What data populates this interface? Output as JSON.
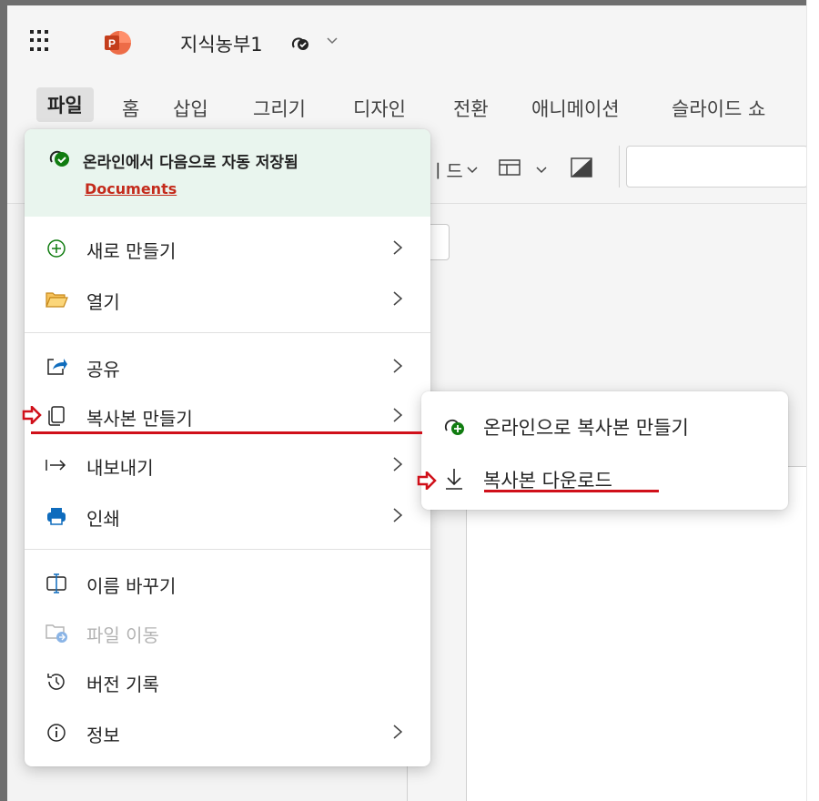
{
  "app": {
    "title": "지식농부1",
    "logo_letter": "P"
  },
  "tabs": [
    {
      "label": "파일",
      "active": true
    },
    {
      "label": "홈"
    },
    {
      "label": "삽입"
    },
    {
      "label": "그리기"
    },
    {
      "label": "디자인"
    },
    {
      "label": "전환"
    },
    {
      "label": "애니메이션"
    },
    {
      "label": "슬라이드 쇼"
    }
  ],
  "ribbon": {
    "fragment_label": "ㅣ드"
  },
  "file_menu": {
    "save_status": "온라인에서 다음으로 자동 저장됨",
    "save_location": "Documents",
    "items": [
      {
        "label": "새로 만들기",
        "icon": "plus-circle-icon",
        "has_submenu": true
      },
      {
        "label": "열기",
        "icon": "folder-open-icon",
        "has_submenu": true
      },
      {
        "label": "공유",
        "icon": "share-icon",
        "has_submenu": true
      },
      {
        "label": "복사본 만들기",
        "icon": "copy-icon",
        "has_submenu": true,
        "highlighted": true
      },
      {
        "label": "내보내기",
        "icon": "export-arrow-icon",
        "has_submenu": true
      },
      {
        "label": "인쇄",
        "icon": "printer-icon",
        "has_submenu": true
      },
      {
        "label": "이름 바꾸기",
        "icon": "rename-icon",
        "has_submenu": false
      },
      {
        "label": "파일 이동",
        "icon": "move-folder-icon",
        "has_submenu": false,
        "disabled": true
      },
      {
        "label": "버전 기록",
        "icon": "history-icon",
        "has_submenu": false
      },
      {
        "label": "정보",
        "icon": "info-icon",
        "has_submenu": true
      }
    ]
  },
  "copy_submenu": {
    "items": [
      {
        "label": "온라인으로 복사본 만들기",
        "icon": "cloud-add-icon"
      },
      {
        "label": "복사본 다운로드",
        "icon": "download-icon",
        "highlighted": true
      }
    ]
  },
  "colors": {
    "accent_red": "#d0101a",
    "save_header_bg": "#e9f5ee",
    "link_red": "#c42b1c",
    "ppt_orange": "#c43e1c",
    "save_green": "#107c10"
  }
}
